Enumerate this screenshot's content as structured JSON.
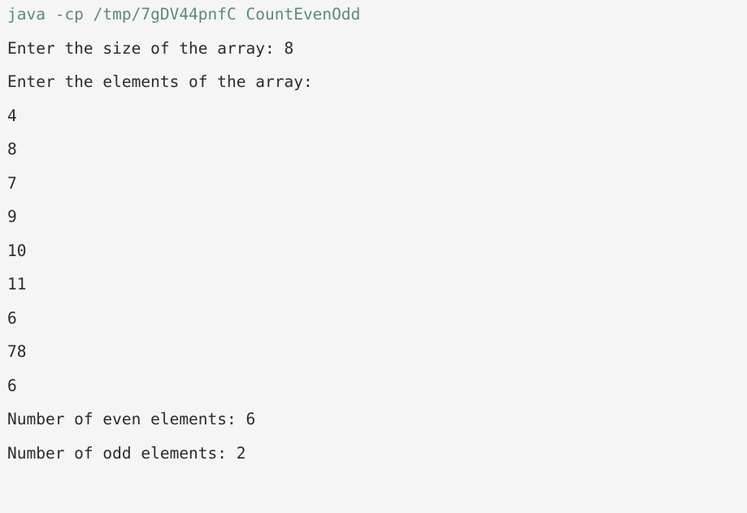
{
  "console": {
    "command": "java -cp /tmp/7gDV44pnfC CountEvenOdd",
    "output_lines": [
      "Enter the size of the array: 8",
      "Enter the elements of the array:",
      "4",
      "8",
      "7",
      "9",
      "10",
      "11",
      "6",
      "78",
      "6",
      "Number of even elements: 6",
      "Number of odd elements: 2"
    ]
  },
  "colors": {
    "background": "#f5f5f5",
    "command_text": "#5b8a80",
    "output_text": "#2b2b2b"
  }
}
